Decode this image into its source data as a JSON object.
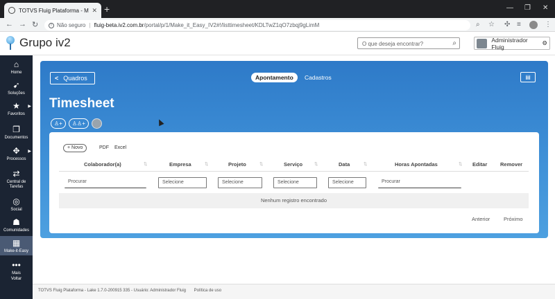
{
  "browser": {
    "tab_title": "TOTVS Fluig Plataforma - Make-it",
    "tab_close": "✕",
    "new_tab": "+",
    "warning": "Não seguro",
    "url_host": "fluig-beta.iv2.com.br",
    "url_path": "/portal/p/1/Make_it_Easy_IV2#!/listtimesheet/KDLTwZ1qO7zbqj9gLimM"
  },
  "header": {
    "brand": "Grupo iv2",
    "search_placeholder": "O que deseja encontrar?",
    "user_label": "Administrador Fluig"
  },
  "sidebar": {
    "items": [
      {
        "label": "Home",
        "icon": "home-icon"
      },
      {
        "label": "Soluções",
        "icon": "rocket-icon"
      },
      {
        "label": "Favoritos",
        "icon": "star-icon"
      },
      {
        "label": "Documentos",
        "icon": "documents-icon"
      },
      {
        "label": "Processos",
        "icon": "processes-icon"
      },
      {
        "label": "Central de Tarefas",
        "icon": "tasks-icon"
      },
      {
        "label": "Social",
        "icon": "chat-icon"
      },
      {
        "label": "Comunidades",
        "icon": "community-icon"
      },
      {
        "label": "Make-it-Easy",
        "icon": "make-it-easy-icon"
      },
      {
        "label": "Mais",
        "icon": "more-icon"
      },
      {
        "label": "Voltar",
        "icon": ""
      }
    ]
  },
  "main": {
    "back_label": "Quadros",
    "tabs": [
      {
        "label": "Apontamento"
      },
      {
        "label": "Cadastros"
      }
    ],
    "page_title": "Timesheet",
    "new_label": "Novo",
    "export_pdf": "PDF",
    "export_excel": "Excel",
    "columns": [
      "Colaborador(a)",
      "Empresa",
      "Projeto",
      "Serviço",
      "Data",
      "Horas Apontadas",
      "Editar",
      "Remover"
    ],
    "filters": {
      "colaborador": "Procurar",
      "empresa": "Selecione",
      "projeto": "Selecione",
      "servico": "Selecione",
      "data": "Selecione",
      "horas": "Procurar"
    },
    "empty_text": "Nenhum registro encontrado",
    "prev": "Anterior",
    "next": "Próximo"
  },
  "footer": {
    "version": "TOTVS Fluig Plataforma - Lake 1.7.0-200915 335 - Usuário: Administrador Fluig",
    "policy": "Política de uso"
  }
}
